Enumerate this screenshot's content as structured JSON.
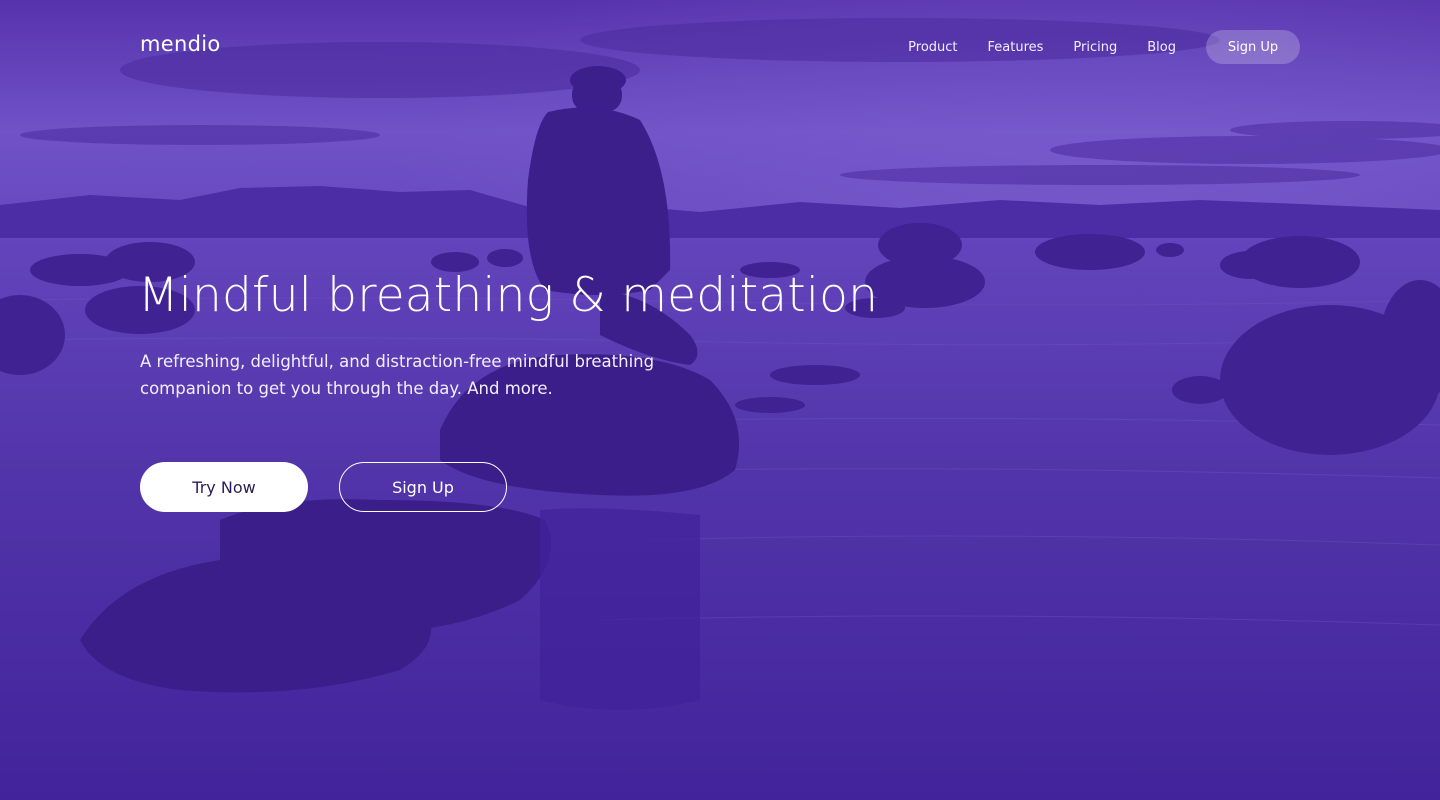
{
  "brand": {
    "logo": "mendio"
  },
  "nav": {
    "links": [
      "Product",
      "Features",
      "Pricing",
      "Blog"
    ],
    "signup_label": "Sign Up"
  },
  "hero": {
    "headline": "Mindful breathing & meditation",
    "subtitle": "A refreshing, delightful, and distraction-free mindful breathing companion to get you through the day. And more.",
    "primary_cta": "Try Now",
    "secondary_cta": "Sign Up"
  },
  "colors": {
    "overlay": "#4a2a9e",
    "water": "#5b3cb5",
    "sky": "#7150c8",
    "rock": "#3a1f80",
    "button_bg": "#ffffff",
    "button_text": "#2b1d55"
  }
}
